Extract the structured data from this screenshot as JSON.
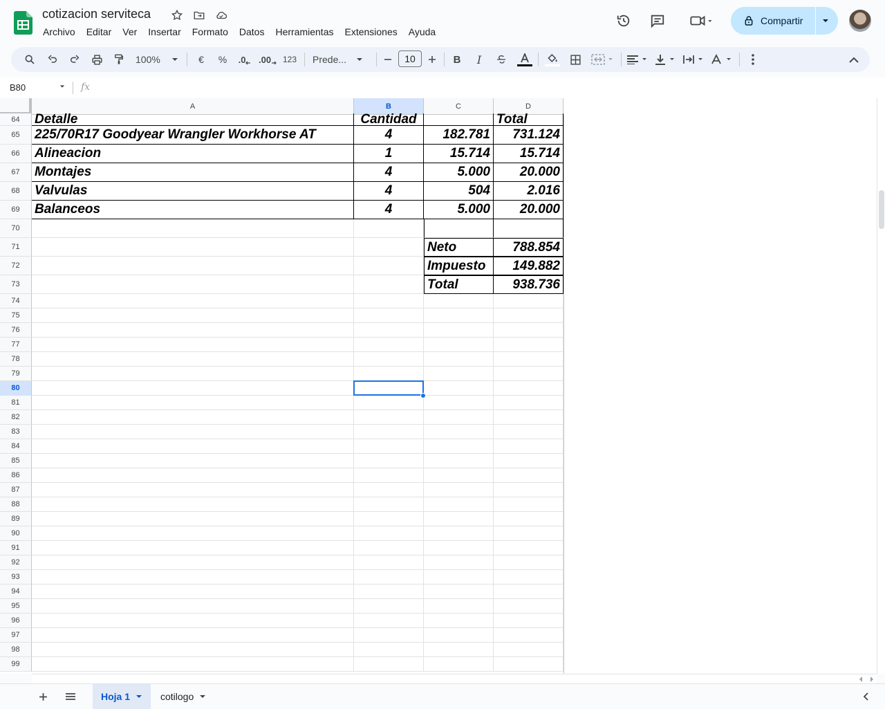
{
  "app": {
    "title": "cotizacion serviteca"
  },
  "menu": [
    "Archivo",
    "Editar",
    "Ver",
    "Insertar",
    "Formato",
    "Datos",
    "Herramientas",
    "Extensiones",
    "Ayuda"
  ],
  "share": {
    "label": "Compartir"
  },
  "toolbar": {
    "zoom": "100%",
    "currency": "€",
    "percent": "%",
    "dec_decrease": ".0",
    "dec_increase": ".00",
    "format_123": "123",
    "font": "Prede...",
    "font_size": "10"
  },
  "formula": {
    "cell_ref": "B80",
    "fx": "fx"
  },
  "columns": [
    "A",
    "B",
    "C",
    "D"
  ],
  "rows": [
    {
      "n": "64"
    },
    {
      "n": "65"
    },
    {
      "n": "66"
    },
    {
      "n": "67"
    },
    {
      "n": "68"
    },
    {
      "n": "69"
    },
    {
      "n": "70"
    },
    {
      "n": "71"
    },
    {
      "n": "72"
    },
    {
      "n": "73"
    },
    {
      "n": "74"
    },
    {
      "n": "75"
    },
    {
      "n": "76"
    },
    {
      "n": "77"
    },
    {
      "n": "78"
    },
    {
      "n": "79"
    },
    {
      "n": "80"
    },
    {
      "n": "81"
    },
    {
      "n": "82"
    },
    {
      "n": "83"
    },
    {
      "n": "84"
    },
    {
      "n": "85"
    },
    {
      "n": "86"
    },
    {
      "n": "87"
    },
    {
      "n": "88"
    },
    {
      "n": "89"
    },
    {
      "n": "90"
    },
    {
      "n": "91"
    },
    {
      "n": "92"
    },
    {
      "n": "93"
    },
    {
      "n": "94"
    },
    {
      "n": "95"
    },
    {
      "n": "96"
    },
    {
      "n": "97"
    },
    {
      "n": "98"
    },
    {
      "n": "99"
    }
  ],
  "table": {
    "header": {
      "a": "Detalle",
      "b": "Cantidad",
      "c": "",
      "d": "Total"
    },
    "items": [
      {
        "a": "225/70R17 Goodyear Wrangler Workhorse AT",
        "b": "4",
        "c": "182.781",
        "d": "731.124"
      },
      {
        "a": "Alineacion",
        "b": "1",
        "c": "15.714",
        "d": "15.714"
      },
      {
        "a": "Montajes",
        "b": "4",
        "c": "5.000",
        "d": "20.000"
      },
      {
        "a": "Valvulas",
        "b": "4",
        "c": "504",
        "d": "2.016"
      },
      {
        "a": "Balanceos",
        "b": "4",
        "c": "5.000",
        "d": "20.000"
      }
    ],
    "totals": [
      {
        "label": "Neto",
        "value": "788.854"
      },
      {
        "label": "Impuesto",
        "value": "149.882"
      },
      {
        "label": "Total",
        "value": "938.736"
      }
    ]
  },
  "sheets": [
    {
      "name": "Hoja 1",
      "active": true
    },
    {
      "name": "cotilogo",
      "active": false
    }
  ]
}
